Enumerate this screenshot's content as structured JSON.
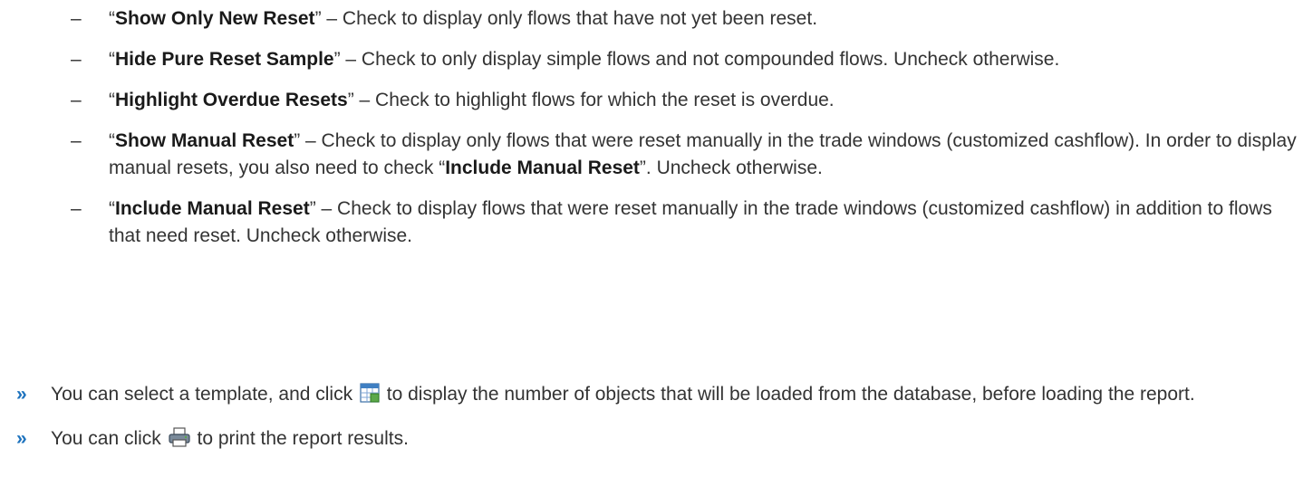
{
  "options": [
    {
      "open_quote": "“",
      "term": "Show Only New Reset",
      "desc": "” – Check to display only flows that have not yet been reset."
    },
    {
      "open_quote": "“",
      "term": "Hide Pure Reset Sample",
      "desc": "” – Check to only display simple flows and not compounded flows. Uncheck otherwise."
    },
    {
      "open_quote": "“",
      "term": "Highlight Overdue Resets",
      "desc": "” – Check to highlight flows for which the reset is overdue."
    },
    {
      "open_quote": "“",
      "term": "Show Manual Reset",
      "desc": "” – Check to display only flows that were reset manually in the trade windows (customized cashflow). In order to display manual resets, you also need to check “",
      "term2": "Include Manual Reset",
      "desc2": "”. Uncheck otherwise."
    },
    {
      "open_quote": "“",
      "term": "Include Manual Reset",
      "desc": "” – Check to display flows that were reset manually in the trade windows (customized cashflow) in addition to flows that need reset. Uncheck otherwise."
    }
  ],
  "dash_symbol": "–",
  "bullet_symbol": "»",
  "bullets": [
    {
      "before": "You can select a template, and click",
      "icon": "object-count-icon",
      "after": "to display the number of objects that will be loaded from the database, before loading the report."
    },
    {
      "before": "You can click",
      "icon": "print-icon",
      "after": "to print the report results."
    }
  ],
  "colors": {
    "text": "#333333",
    "keyword": "#1a1a1a",
    "bullet": "#1e73be"
  }
}
